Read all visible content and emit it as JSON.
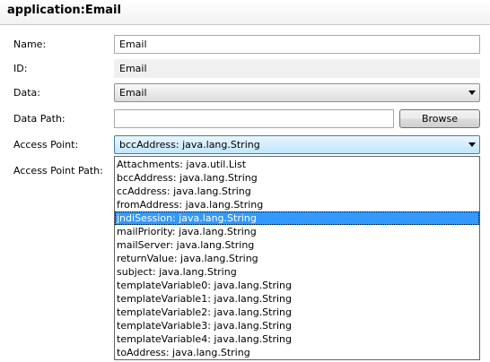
{
  "header": {
    "title": "application:Email"
  },
  "form": {
    "name_label": "Name:",
    "name_value": "Email",
    "id_label": "ID:",
    "id_value": "Email",
    "data_label": "Data:",
    "data_value": "Email",
    "data_path_label": "Data Path:",
    "data_path_value": "",
    "browse_label": "Browse",
    "access_point_label": "Access Point:",
    "access_point_value": "bccAddress: java.lang.String",
    "access_point_path_label": "Access Point Path:"
  },
  "dropdown": {
    "selected_index": 4,
    "options": [
      "Attachments: java.util.List",
      "bccAddress: java.lang.String",
      "ccAddress: java.lang.String",
      "fromAddress: java.lang.String",
      "jndiSession: java.lang.String",
      "mailPriority: java.lang.String",
      "mailServer: java.lang.String",
      "returnValue: java.lang.String",
      "subject: java.lang.String",
      "templateVariable0: java.lang.String",
      "templateVariable1: java.lang.String",
      "templateVariable2: java.lang.String",
      "templateVariable3: java.lang.String",
      "templateVariable4: java.lang.String",
      "toAddress: java.lang.String"
    ]
  },
  "colors": {
    "selection": "#3399ff",
    "header_border": "#c8c8c8"
  }
}
